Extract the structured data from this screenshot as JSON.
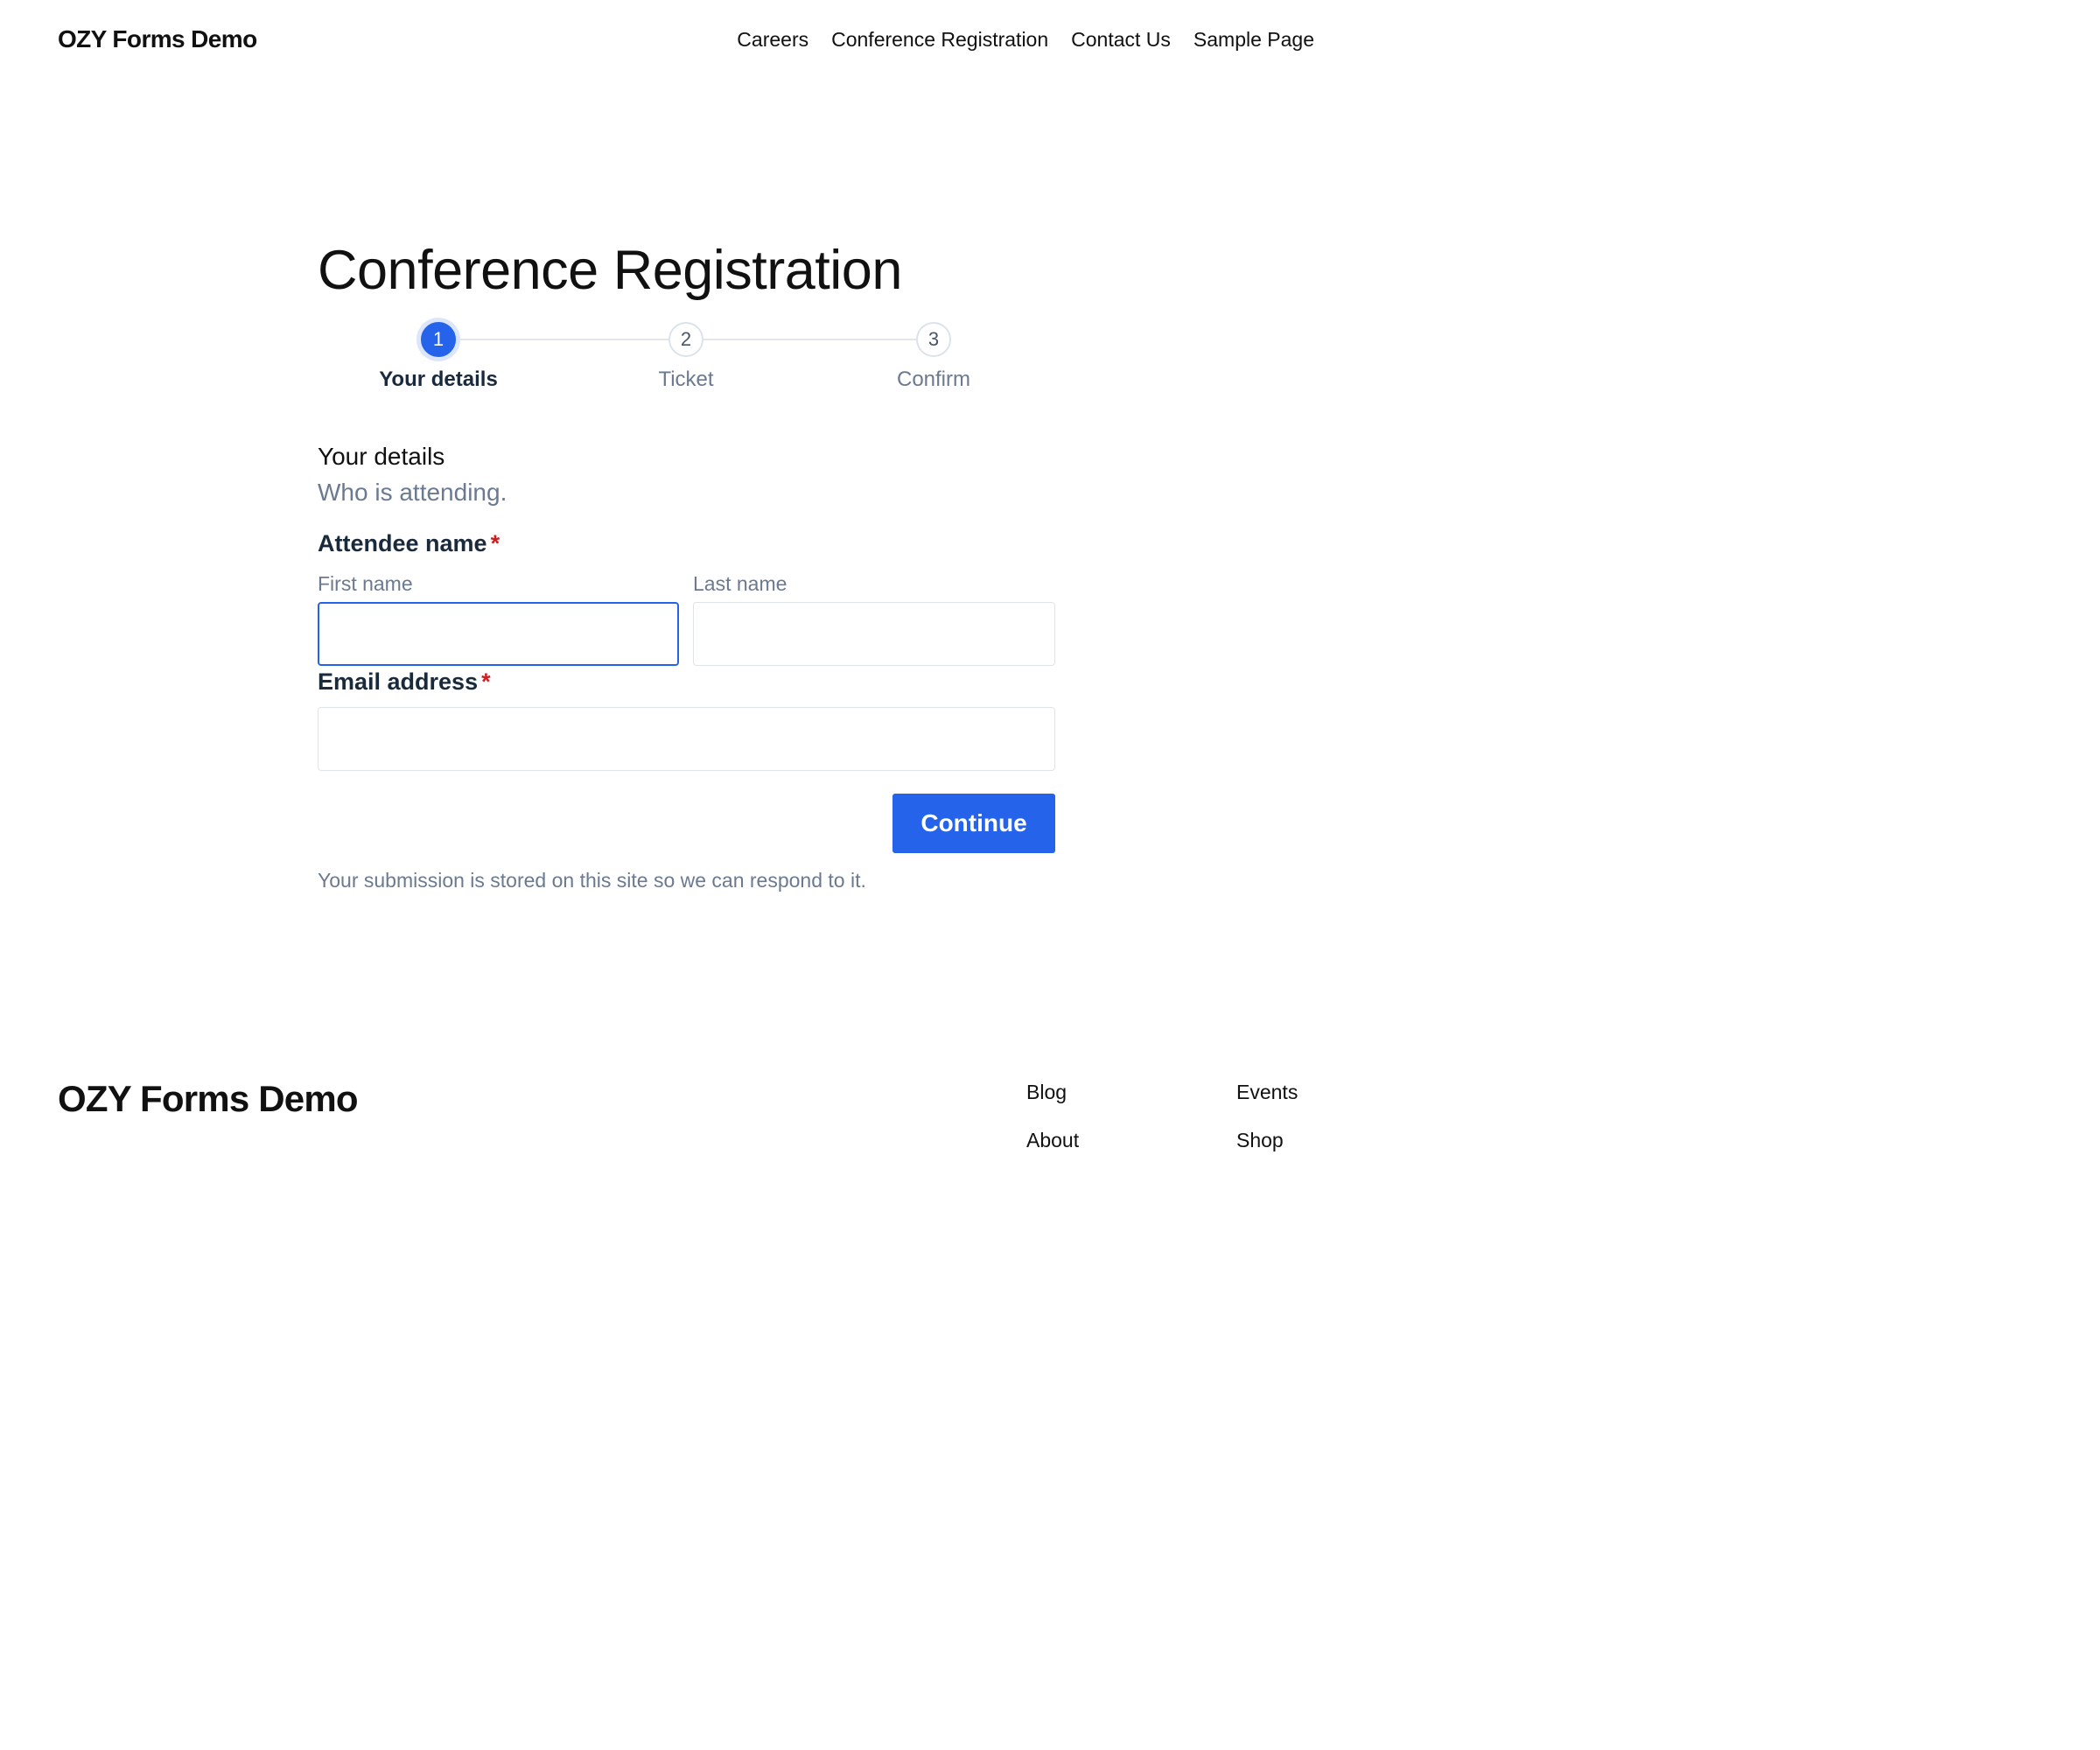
{
  "header": {
    "brand": "OZY Forms Demo",
    "nav": [
      "Careers",
      "Conference Registration",
      "Contact Us",
      "Sample Page"
    ]
  },
  "page": {
    "title": "Conference Registration"
  },
  "steps": [
    {
      "number": "1",
      "label": "Your details",
      "state": "active"
    },
    {
      "number": "2",
      "label": "Ticket",
      "state": "upcoming"
    },
    {
      "number": "3",
      "label": "Confirm",
      "state": "upcoming"
    }
  ],
  "form": {
    "section_title": "Your details",
    "section_subtitle": "Who is attending.",
    "attendee_label": "Attendee name",
    "required_marker": "*",
    "first_name_label": "First name",
    "first_name_value": "",
    "last_name_label": "Last name",
    "last_name_value": "",
    "email_label": "Email address",
    "email_value": "",
    "continue_label": "Continue",
    "note": "Your submission is stored on this site so we can respond to it."
  },
  "footer": {
    "brand": "OZY Forms Demo",
    "links": [
      "Blog",
      "Events",
      "About",
      "Shop"
    ]
  },
  "colors": {
    "accent": "#2563eb",
    "required": "#cc1f1f",
    "muted_text": "#6b7a90"
  }
}
